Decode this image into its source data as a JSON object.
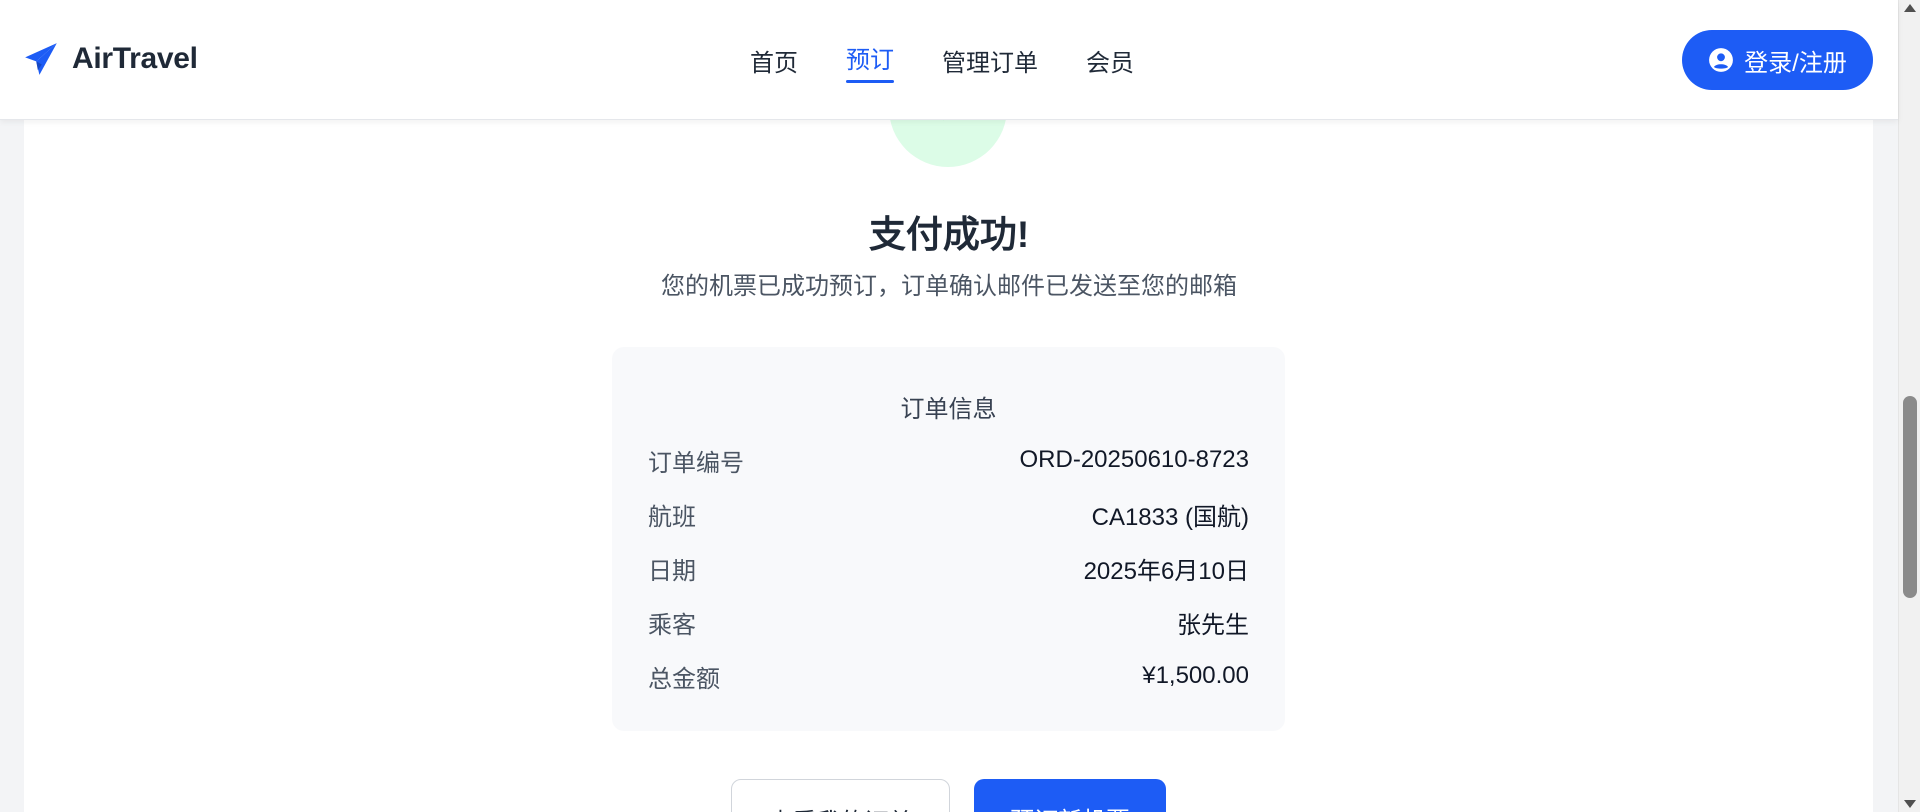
{
  "header": {
    "brand": "AirTravel",
    "nav": [
      {
        "label": "首页",
        "active": false
      },
      {
        "label": "预订",
        "active": true
      },
      {
        "label": "管理订单",
        "active": false
      },
      {
        "label": "会员",
        "active": false
      }
    ],
    "login_label": "登录/注册"
  },
  "colors": {
    "accent": "#1d5cf5",
    "success_bg": "#dcfce7",
    "success_icon": "#22c55e"
  },
  "icons": {
    "logo": "paper-plane-icon",
    "login": "user-circle-icon",
    "success": "check-icon"
  },
  "main": {
    "title": "支付成功!",
    "subtitle": "您的机票已成功预订，订单确认邮件已发送至您的邮箱"
  },
  "order": {
    "title": "订单信息",
    "rows": [
      {
        "label": "订单编号",
        "value": "ORD-20250610-8723"
      },
      {
        "label": "航班",
        "value": "CA1833 (国航)"
      },
      {
        "label": "日期",
        "value": "2025年6月10日"
      },
      {
        "label": "乘客",
        "value": "张先生"
      },
      {
        "label": "总金额",
        "value": "¥1,500.00"
      }
    ]
  },
  "actions": {
    "view_orders": "查看我的订单",
    "book_new": "预订新机票"
  }
}
